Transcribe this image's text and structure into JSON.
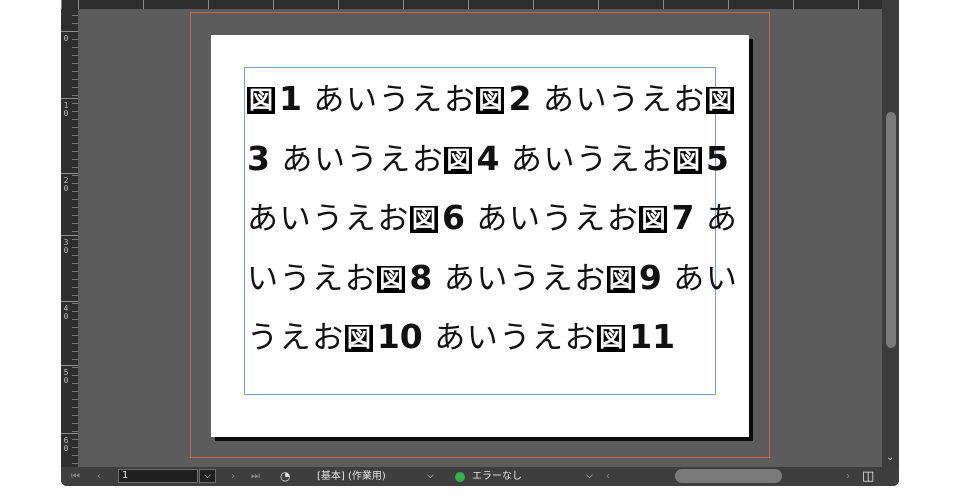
{
  "ruler": {
    "left_labels": [
      "0",
      "1\n0",
      "2\n0",
      "3\n0",
      "4\n0",
      "5\n0",
      "6\n0"
    ]
  },
  "document": {
    "segments": [
      {
        "figure": "図",
        "number": "1",
        "text": " あいうえお"
      },
      {
        "figure": "図",
        "number": "2",
        "text": " あいうえお"
      },
      {
        "figure": "図",
        "number": "3",
        "text": " あいうえお"
      },
      {
        "figure": "図",
        "number": "4",
        "text": " あいうえお"
      },
      {
        "figure": "図",
        "number": "5",
        "text": " あいうえお"
      },
      {
        "figure": "図",
        "number": "6",
        "text": " あいうえお"
      },
      {
        "figure": "図",
        "number": "7",
        "text": " あいうえお"
      },
      {
        "figure": "図",
        "number": "8",
        "text": " あいうえお"
      },
      {
        "figure": "図",
        "number": "9",
        "text": " あいうえお"
      },
      {
        "figure": "図",
        "number": "10",
        "text": " あいうえお"
      },
      {
        "figure": "図",
        "number": "11",
        "text": ""
      }
    ]
  },
  "statusbar": {
    "first_icon": "⏮",
    "prev_icon": "‹",
    "page_value": "1",
    "page_dropdown_icon": "⌵",
    "next_icon": "›",
    "last_icon": "⏭",
    "preflight_icon": "◔",
    "profile_label": "[基本] (作業用)",
    "profile_dropdown_icon": "⌵",
    "status_color": "#2fb34a",
    "status_label": "エラーなし",
    "status_dropdown_icon": "⌵",
    "scroll_left_icon": "‹",
    "scroll_right_icon": "›",
    "panel_icon": "◫"
  },
  "colors": {
    "bleed": "#d0605a",
    "frame": "#7a9ad6",
    "pasteboard": "#5c5c5c"
  }
}
